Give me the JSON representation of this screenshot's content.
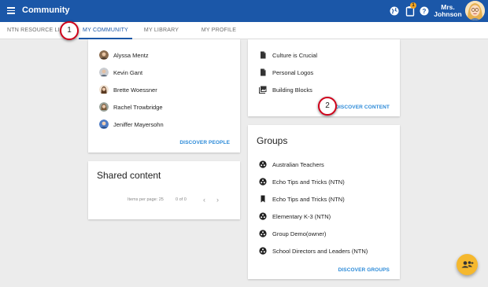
{
  "appbar": {
    "title": "Community",
    "notification_count": "1",
    "user_name": "Mrs. Johnson",
    "user_name_line1": "Mrs.",
    "user_name_line2": "Johnson"
  },
  "tabs": [
    {
      "label": "NTN RESOURCE LIBRARY",
      "visible_label": "NTN RESOURCE LIBRA"
    },
    {
      "label": "MY COMMUNITY",
      "active": true
    },
    {
      "label": "MY LIBRARY"
    },
    {
      "label": "MY PROFILE"
    }
  ],
  "callouts": [
    "1",
    "2"
  ],
  "people": {
    "items": [
      "Alyssa Mentz",
      "Kevin Gant",
      "Brette Woessner",
      "Rachel Trowbridge",
      "Jeniffer Mayersohn"
    ],
    "action": "DISCOVER PEOPLE"
  },
  "shared": {
    "title": "Shared content",
    "items_per_page_label": "Items per page:",
    "items_per_page_value": "25",
    "range": "0 of 0"
  },
  "content": {
    "items": [
      "Culture is Crucial",
      "Personal Logos",
      "Building Blocks"
    ],
    "action": "DISCOVER CONTENT"
  },
  "groups": {
    "title": "Groups",
    "items": [
      "Australian Teachers",
      "Echo Tips and Tricks (NTN)",
      "Echo Tips and Tricks (NTN)",
      "Elementary K-3 (NTN)",
      "Group Demo(owner)",
      "School Directors and Leaders (NTN)"
    ],
    "action": "DISCOVER GROUPS"
  },
  "colors": {
    "appbar": "#1b57a8",
    "link": "#2b8ad8",
    "callout_border": "#d0021b",
    "fab": "#f5b82e",
    "badge": "#f5a623"
  }
}
